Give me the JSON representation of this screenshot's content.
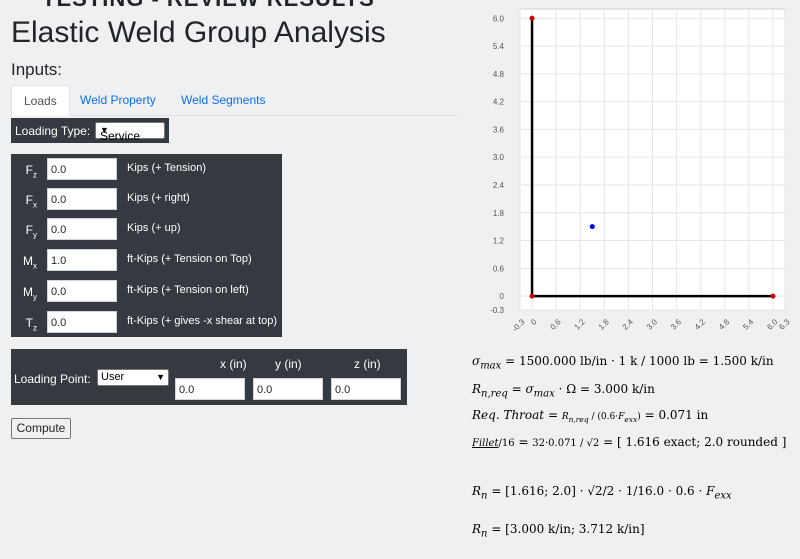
{
  "banner": "TESTING - REVIEW RESULTS",
  "title": "Elastic Weld Group Analysis",
  "subtitle": "Inputs:",
  "tabs": [
    {
      "label": "Loads"
    },
    {
      "label": "Weld Property"
    },
    {
      "label": "Weld Segments"
    }
  ],
  "loading_type": {
    "label": "Loading Type:",
    "value": "Service"
  },
  "loads": [
    {
      "sym": "F",
      "sub": "z",
      "value": "0.0",
      "desc": "Kips (+ Tension)"
    },
    {
      "sym": "F",
      "sub": "x",
      "value": "0.0",
      "desc": "Kips (+ right)"
    },
    {
      "sym": "F",
      "sub": "y",
      "value": "0.0",
      "desc": "Kips (+ up)"
    },
    {
      "sym": "M",
      "sub": "x",
      "value": "1.0",
      "desc": "ft-Kips (+ Tension on Top)"
    },
    {
      "sym": "M",
      "sub": "y",
      "value": "0.0",
      "desc": "ft-Kips (+ Tension on left)"
    },
    {
      "sym": "T",
      "sub": "z",
      "value": "0.0",
      "desc": "ft-Kips (+ gives -x shear at top)"
    }
  ],
  "loading_point": {
    "label": "Loading Point:",
    "mode": "User",
    "x_header": "x (in)",
    "y_header": "y (in)",
    "z_header": "z (in)",
    "x": "0.0",
    "y": "0.0",
    "z": "0.0"
  },
  "compute_label": "Compute",
  "chart_data": {
    "type": "line",
    "x_ticks": [
      "-0.3",
      "0",
      "0.6",
      "1.2",
      "1.8",
      "2.4",
      "3.0",
      "3.6",
      "4.2",
      "4.8",
      "5.4",
      "6.0",
      "6.3"
    ],
    "y_ticks": [
      "-0.3",
      "0",
      "0.6",
      "1.2",
      "1.8",
      "2.4",
      "3.0",
      "3.6",
      "4.2",
      "4.8",
      "5.4",
      "6.0"
    ],
    "xlim": [
      -0.3,
      6.3
    ],
    "ylim": [
      -0.3,
      6.2
    ],
    "grid": true,
    "segments": [
      {
        "x": [
          0,
          0
        ],
        "y": [
          0,
          6.0
        ]
      },
      {
        "x": [
          0,
          6.0
        ],
        "y": [
          0,
          0
        ]
      }
    ],
    "end_points": [
      {
        "x": 0,
        "y": 6.0
      },
      {
        "x": 0,
        "y": 0
      },
      {
        "x": 6.0,
        "y": 0
      }
    ],
    "centroid": {
      "x": 1.5,
      "y": 1.5
    },
    "colors": {
      "segment": "#000000",
      "end_point": "#cc0000",
      "centroid": "#0000ee",
      "grid": "#e6e6e6"
    }
  },
  "results": {
    "sigma_max": "1500.000 lb/in · 1 k / 1000 lb = 1.500 k/in",
    "rn_req": "3.000 k/in",
    "req_throat": "0.071 in",
    "fillet_expr": "32·0.071 / √2",
    "fillet_exact": "1.616",
    "fillet_exact_label": "exact",
    "fillet_rounded": "2.0",
    "fillet_rounded_label": "rounded",
    "rn_factor": "1/16.0",
    "rn_1": "3.000 k/in",
    "rn_2": "3.712 k/in"
  }
}
